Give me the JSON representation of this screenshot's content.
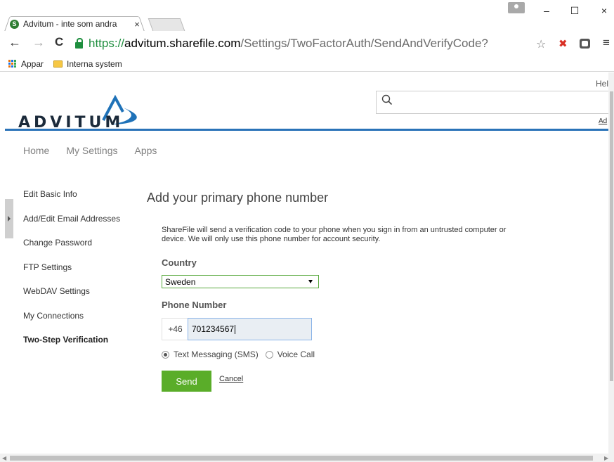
{
  "browser": {
    "tab_title": "Advitum - inte som andra",
    "tab_close": "×",
    "favicon_glyph": "S",
    "url_scheme": "https://",
    "url_host": "advitum.sharefile.com",
    "url_path": "/Settings/TwoFactorAuth/SendAndVerifyCode?",
    "window_controls": {
      "minimize": "–",
      "maximize": "☐",
      "close": "×"
    },
    "nav": {
      "back": "←",
      "forward": "→",
      "reload": "C"
    },
    "star": "☆",
    "menu": "≡",
    "bookmarks": [
      {
        "label": "Appar",
        "icon": "apps-grid-icon"
      },
      {
        "label": "Interna system",
        "icon": "folder-icon"
      }
    ]
  },
  "header": {
    "logo_text": "ADVITUM",
    "help_label": "Hel",
    "admin_label": "Ad",
    "search_placeholder": "",
    "accent_color": "#2a73b8"
  },
  "topnav": {
    "items": [
      "Home",
      "My Settings",
      "Apps"
    ]
  },
  "sidebar": {
    "items": [
      "Edit Basic Info",
      "Add/Edit Email Addresses",
      "Change Password",
      "FTP Settings",
      "WebDAV Settings",
      "My Connections",
      "Two-Step Verification"
    ],
    "active_index": 6
  },
  "form": {
    "title": "Add your primary phone number",
    "description": "ShareFile will send a verification code to your phone when you sign in from an untrusted computer or device. We will only use this phone number for account security.",
    "country_label": "Country",
    "country_value": "Sweden",
    "phone_label": "Phone Number",
    "phone_prefix": "+46",
    "phone_value": "701234567",
    "method_options": [
      {
        "label": "Text Messaging (SMS)",
        "checked": true
      },
      {
        "label": "Voice Call",
        "checked": false
      }
    ],
    "send_label": "Send",
    "cancel_label": "Cancel",
    "send_color": "#5aad29"
  }
}
